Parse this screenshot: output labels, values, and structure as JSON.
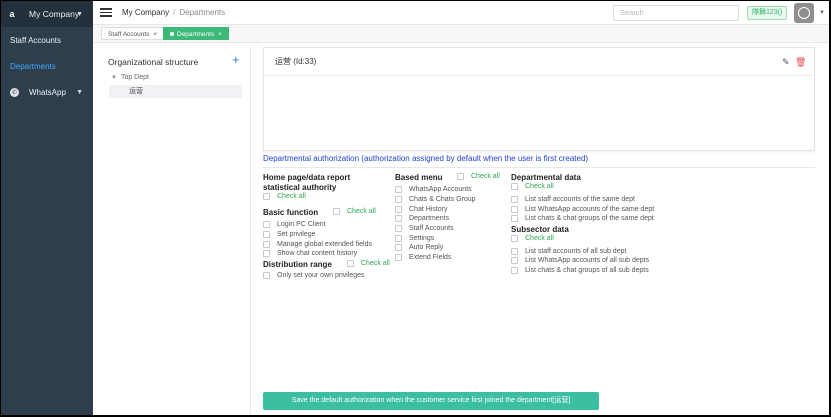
{
  "sidebar": {
    "company": "My Company",
    "items": [
      {
        "label": "Staff Accounts"
      },
      {
        "label": "Departments"
      },
      {
        "label": "WhatsApp"
      }
    ]
  },
  "header": {
    "breadcrumb_root": "My Company",
    "breadcrumb_sep": "/",
    "breadcrumb_current": "Departments",
    "search_placeholder": "Search",
    "badge": "隊舞123()"
  },
  "tabs": [
    {
      "label": "Staff Accounts"
    },
    {
      "label": "Departments"
    }
  ],
  "tree": {
    "title": "Organizational structure",
    "root": "Top Dept",
    "child": "运营"
  },
  "card": {
    "title": "运营 (Id:33)"
  },
  "auth": {
    "title": "Departmental authorization (authorization assigned by default when the user is first created)",
    "check_all": "Check all",
    "home_title": "Home page/data report statistical authority",
    "basic_title": "Basic function",
    "basic_items": [
      "Login PC Client",
      "Set privilege",
      "Manage global extended fields",
      "Show chat content history"
    ],
    "dist_title": "Distribution range",
    "dist_items": [
      "Only set your own privileges"
    ],
    "based_title": "Based menu",
    "based_items": [
      "WhatsApp Accounts",
      "Chats & Chats Group",
      "Chat History",
      "Departments",
      "Staff Accounts",
      "Settings",
      "Auto Reply",
      "Extend Fields"
    ],
    "dept_title": "Departmental data",
    "dept_items": [
      "List staff accounts of the same dept",
      "List WhatsApp accounts of the same dept",
      "List chats & chat groups of the same dept"
    ],
    "sub_title": "Subsector data",
    "sub_items": [
      "List staff accounts of all sub dept",
      "List WhatsApp accounts of all sub depts",
      "List chats & chat groups of all sub depts"
    ]
  },
  "save_button": "Save the default authorization when the customer service first joined the department[运营]"
}
